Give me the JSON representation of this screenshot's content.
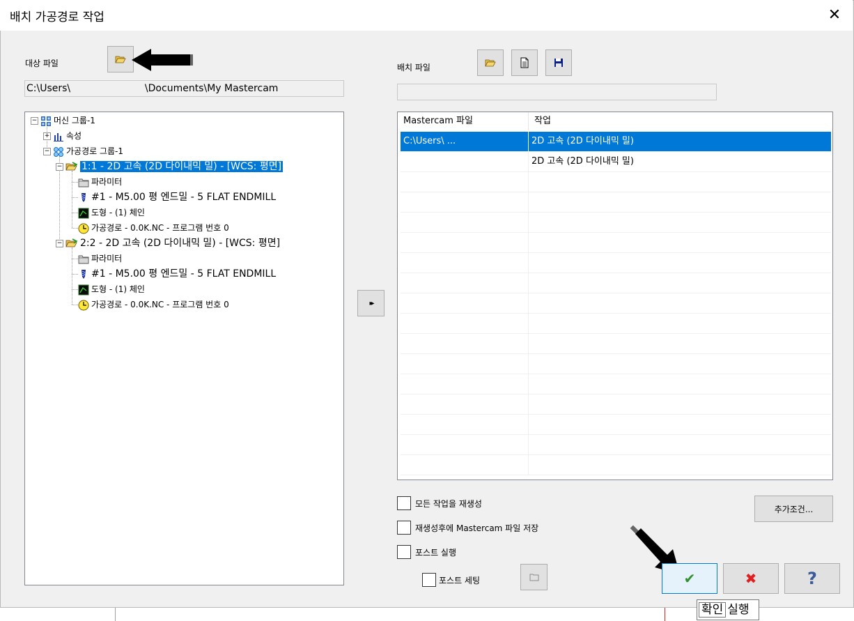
{
  "window": {
    "title": "배치 가공경로 작업",
    "close_glyph": "✕"
  },
  "source": {
    "label": "대상 파일",
    "path": "C:\\Users\\                        \\Documents\\My Mastercam"
  },
  "batch": {
    "label": "배치 파일",
    "path": ""
  },
  "tree": [
    {
      "expander": "−",
      "icon": "machine-group-icon",
      "text": "머신 그룹-1",
      "selected": false,
      "large": false
    },
    {
      "expander": "+",
      "icon": "properties-icon",
      "text": "속성",
      "selected": false,
      "large": false
    },
    {
      "expander": "−",
      "icon": "toolpath-group-icon",
      "text": "가공경로 그룹-1",
      "selected": false,
      "large": false
    },
    {
      "expander": "−",
      "icon": "operation-folder-icon",
      "text": "1:1 - 2D 고속 (2D 다이내믹 밀) - [WCS: 평면]",
      "selected": true,
      "large": true
    },
    {
      "expander": "",
      "icon": "folder-icon",
      "text": "파라미터",
      "selected": false,
      "large": false
    },
    {
      "expander": "",
      "icon": "tool-icon",
      "text": "#1 - M5.00 평 엔드밀 - 5 FLAT ENDMILL",
      "selected": false,
      "large": true
    },
    {
      "expander": "",
      "icon": "geometry-icon",
      "text": "도형 - (1) 체인",
      "selected": false,
      "large": false
    },
    {
      "expander": "",
      "icon": "clock-icon",
      "text": "가공경로 - 0.0K.NC - 프로그램 번호 0",
      "selected": false,
      "large": false
    },
    {
      "expander": "−",
      "icon": "operation-folder-icon",
      "text": "2:2 - 2D 고속 (2D 다이내믹 밀) - [WCS: 평면]",
      "selected": false,
      "large": true
    },
    {
      "expander": "",
      "icon": "folder-icon",
      "text": "파라미터",
      "selected": false,
      "large": false
    },
    {
      "expander": "",
      "icon": "tool-icon",
      "text": "#1 - M5.00 평 엔드밀 - 5 FLAT ENDMILL",
      "selected": false,
      "large": true
    },
    {
      "expander": "",
      "icon": "geometry-icon",
      "text": "도형 - (1) 체인",
      "selected": false,
      "large": false
    },
    {
      "expander": "",
      "icon": "clock-icon",
      "text": "가공경로 - 0.0K.NC - 프로그램 번호 0",
      "selected": false,
      "large": false
    }
  ],
  "move_button": {
    "glyph": "▸▸",
    "icon": "double-arrow-right-icon"
  },
  "list": {
    "columns": [
      "Mastercam 파일",
      "작업"
    ],
    "rows": [
      [
        "C:\\Users\\             ...",
        "2D 고속 (2D 다이내믹 밀)"
      ],
      [
        "",
        "2D 고속 (2D 다이내믹 밀)"
      ]
    ],
    "selected_row": 0
  },
  "options": {
    "regen_all": "모든 작업을 재생성",
    "save_after": "재생성후에 Mastercam 파일 저장",
    "run_post": "포스트 실행",
    "post_settings": "포스트 세팅",
    "advanced_button": "추가조건..."
  },
  "actions": {
    "ok_glyph": "✔",
    "cancel_glyph": "✖",
    "help_glyph": "?"
  },
  "tooltip": {
    "prefix": "확인",
    "suffix": "실행"
  },
  "colors": {
    "selection": "#0078d7",
    "ok": "#2f8f2f",
    "cancel": "#e02020",
    "help": "#3a5a9a"
  }
}
